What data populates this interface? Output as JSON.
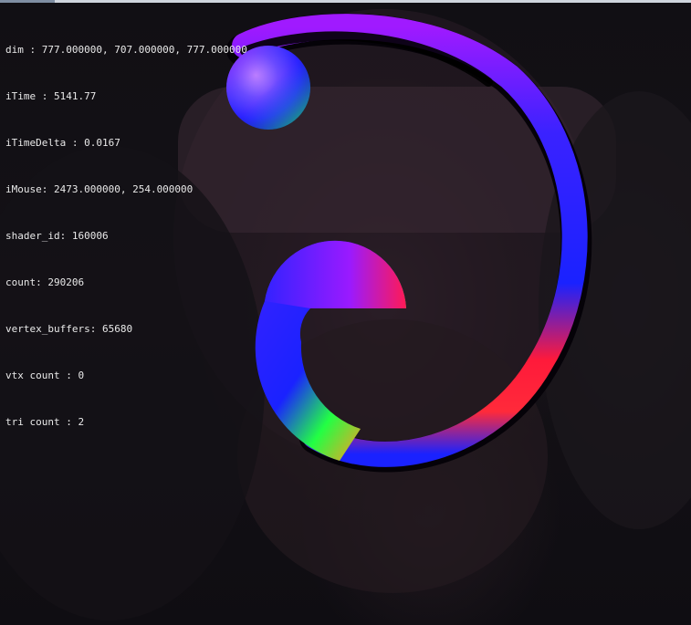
{
  "window": {
    "width": 757,
    "height": 685
  },
  "debug_overlay": {
    "lines": [
      "dim : 777.000000, 707.000000, 777.000000",
      "iTime : 5141.77",
      "iTimeDelta : 0.0167",
      "iMouse: 2473.000000, 254.000000",
      "shader_id: 160006",
      "count: 290206",
      "vertex_buffers: 65680",
      "vtx count : 0",
      "tri count : 2"
    ]
  },
  "scene": {
    "objects": [
      {
        "name": "normal-shaded-sphere",
        "shading": "surface normals as RGB"
      },
      {
        "name": "normal-shaded-spiral-tube",
        "shading": "surface normals as RGB"
      }
    ],
    "colors": {
      "background": "#110f14",
      "text": "#e9e9e9",
      "normal_red": "#ff1a2e",
      "normal_green": "#22ff44",
      "normal_blue": "#1a22ff",
      "normal_magenta": "#c81aff"
    }
  }
}
